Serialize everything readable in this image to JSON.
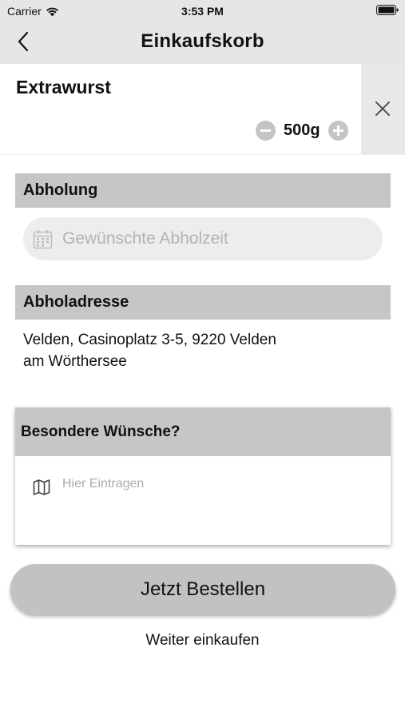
{
  "status_bar": {
    "carrier": "Carrier",
    "time": "3:53 PM"
  },
  "nav": {
    "title": "Einkaufskorb",
    "back_icon": "chevron-left-icon"
  },
  "cart_item": {
    "name": "Extrawurst",
    "quantity": "500g",
    "remove_icon": "close-icon"
  },
  "pickup": {
    "header": "Abholung",
    "time_placeholder": "Gewünschte Abholzeit"
  },
  "pickup_address": {
    "header": "Abholadresse",
    "line1": "Velden, Casinoplatz 3-5, 9220 Velden",
    "line2": "am Wörthersee"
  },
  "wishes": {
    "header": "Besondere Wünsche?",
    "placeholder": "Hier Eintragen"
  },
  "actions": {
    "order_label": "Jetzt Bestellen",
    "continue_label": "Weiter einkaufen"
  },
  "colors": {
    "nav_background": "#e6e6e6",
    "section_header": "#c6c6c6",
    "button_background": "#c2c2c2",
    "placeholder_text": "#b3b3b3"
  }
}
